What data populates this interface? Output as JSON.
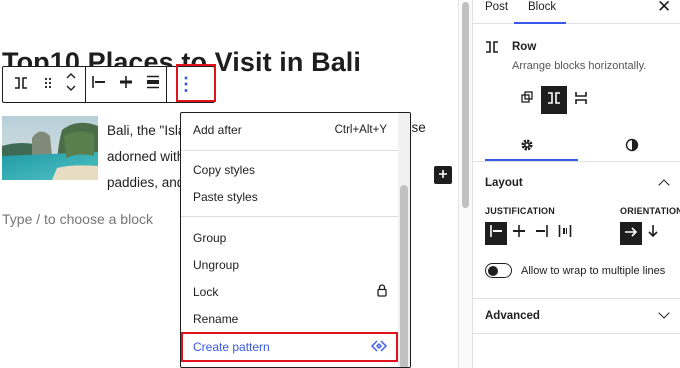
{
  "editor": {
    "post_title": "Top10 Places to Visit in Bali",
    "paragraph_lines": [
      "Bali, the \"Isla",
      "adorned with",
      "paddies, and"
    ],
    "paragraph_right_fragment": "dise",
    "appender_placeholder": "Type / to choose a block",
    "add_block_glyph": "+"
  },
  "block_toolbar": {
    "buttons": [
      {
        "name": "row-block-type-icon"
      },
      {
        "name": "drag-handle-icon"
      },
      {
        "name": "move-up-down-icon"
      },
      {
        "name": "justify-left-icon"
      },
      {
        "name": "justify-center-icon"
      },
      {
        "name": "justify-stretch-icon"
      },
      {
        "name": "more-options-icon"
      }
    ],
    "more_options_glyph": "⋮"
  },
  "options_menu": {
    "items": [
      {
        "label": "Add after",
        "shortcut": "Ctrl+Alt+Y"
      },
      {
        "label": "Copy styles"
      },
      {
        "label": "Paste styles"
      },
      {
        "label": "Group"
      },
      {
        "label": "Ungroup"
      },
      {
        "label": "Lock",
        "icon": "lock-icon"
      },
      {
        "label": "Rename"
      },
      {
        "label": "Create pattern",
        "icon": "pattern-icon",
        "highlighted": true
      }
    ],
    "accent_color": "#3858e9"
  },
  "sidebar": {
    "tabs": [
      {
        "label": "Post",
        "active": false
      },
      {
        "label": "Block",
        "active": true
      }
    ],
    "close_glyph": "✕",
    "block": {
      "name": "Row",
      "description": "Arrange blocks horizontally."
    },
    "variations": [
      "group-icon",
      "row-icon",
      "stack-icon"
    ],
    "settings_tabs": [
      "settings-gear-icon",
      "styles-contrast-icon"
    ],
    "layout": {
      "title": "Layout",
      "justification_label": "JUSTIFICATION",
      "orientation_label": "ORIENTATION",
      "justification_options": [
        "justify-left-icon",
        "justify-center-icon",
        "justify-right-icon",
        "justify-space-between-icon"
      ],
      "orientation_options": [
        "arrow-right-icon",
        "arrow-down-icon"
      ],
      "wrap_toggle_label": "Allow to wrap to multiple lines"
    },
    "advanced": {
      "title": "Advanced"
    }
  },
  "colors": {
    "highlight_red": "#e0121a",
    "wp_blue": "#3858e9",
    "dark": "#1e1e1e"
  }
}
